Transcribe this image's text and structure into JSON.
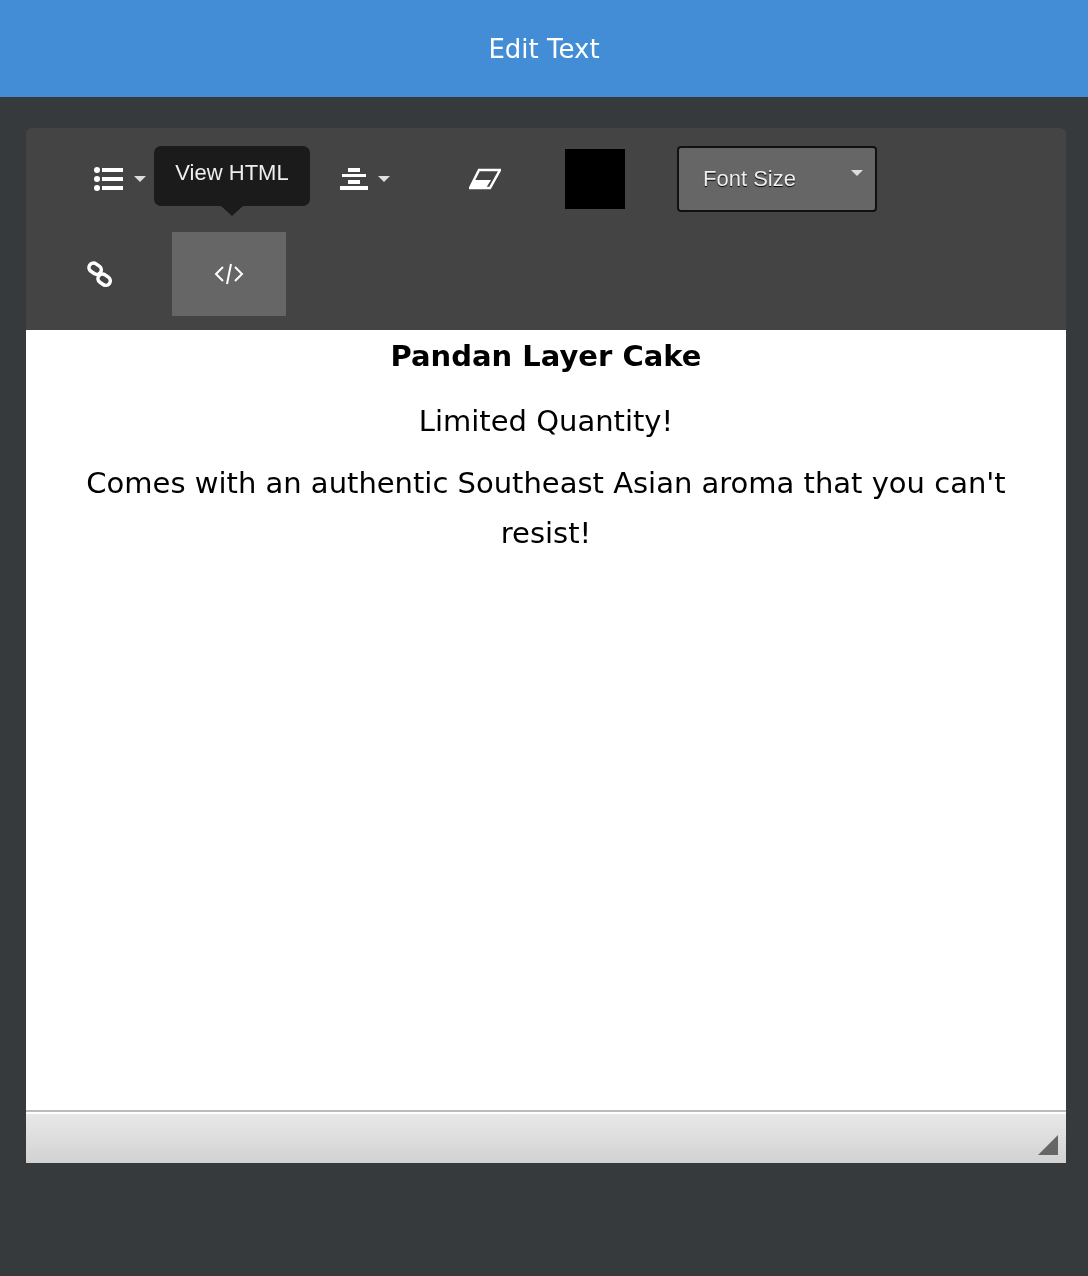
{
  "header": {
    "title": "Edit Text"
  },
  "toolbar": {
    "rows": [
      [
        {
          "kind": "list"
        },
        {
          "kind": "align"
        },
        {
          "kind": "eraser"
        },
        {
          "kind": "color",
          "color": "#000000"
        },
        {
          "kind": "select",
          "label": "Font Size"
        }
      ],
      [
        {
          "kind": "link",
          "selected": false
        },
        {
          "kind": "code",
          "selected": true
        }
      ]
    ],
    "tooltip": "View HTML"
  },
  "content": [
    {
      "kind": "heading",
      "text": "Pandan Layer Cake"
    },
    {
      "kind": "paragraph",
      "text": "Limited Quantity!"
    },
    {
      "kind": "paragraph",
      "text": "Comes with an authentic Southeast Asian aroma that you can't resist!"
    }
  ]
}
